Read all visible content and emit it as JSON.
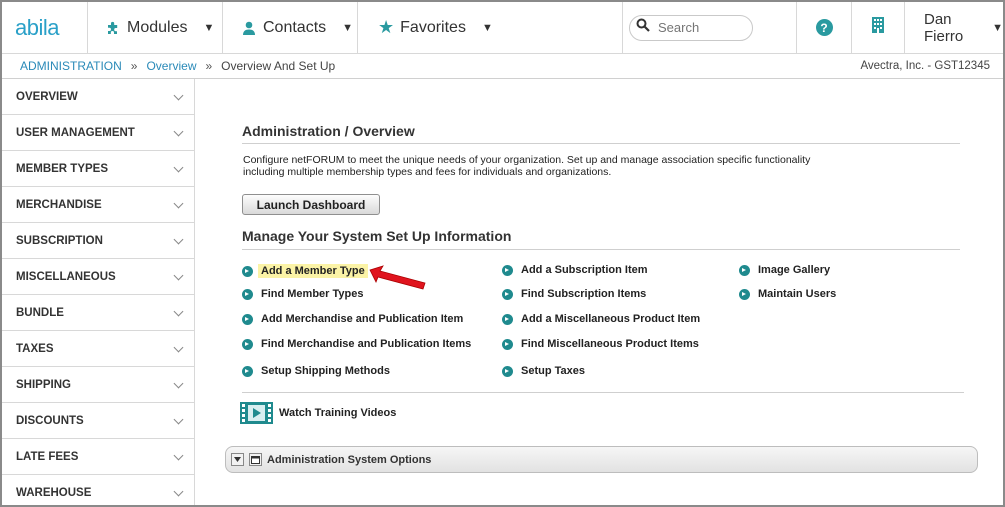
{
  "brand": {
    "logo_text": "abila",
    "accent": "#2aa0c8",
    "icon_color": "#2a9aa0"
  },
  "topnav": {
    "modules": {
      "label": "Modules",
      "icon": "puzzle-icon"
    },
    "contacts": {
      "label": "Contacts",
      "icon": "person-icon"
    },
    "favorites": {
      "label": "Favorites",
      "icon": "star-icon"
    },
    "search": {
      "placeholder": "Search"
    },
    "help_glyph": "?",
    "user": {
      "name": "Dan Fierro"
    }
  },
  "breadcrumb": {
    "items": [
      "ADMINISTRATION",
      "Overview"
    ],
    "separator": "»",
    "current": "Overview And Set Up",
    "org": "Avectra, Inc. - GST12345"
  },
  "sidebar": {
    "items": [
      {
        "label": "OVERVIEW"
      },
      {
        "label": "USER MANAGEMENT"
      },
      {
        "label": "MEMBER TYPES"
      },
      {
        "label": "MERCHANDISE"
      },
      {
        "label": "SUBSCRIPTION"
      },
      {
        "label": "MISCELLANEOUS"
      },
      {
        "label": "BUNDLE"
      },
      {
        "label": "TAXES"
      },
      {
        "label": "SHIPPING"
      },
      {
        "label": "DISCOUNTS"
      },
      {
        "label": "LATE FEES"
      },
      {
        "label": "WAREHOUSE"
      }
    ]
  },
  "main": {
    "heading": "Administration / Overview",
    "description_line1": "Configure netFORUM to meet the unique needs of your organization. Set up and manage association specific functionality",
    "description_line2": "including multiple membership types and fees for individuals and organizations.",
    "launch_button": "Launch Dashboard",
    "setup_heading": "Manage Your System Set Up Information",
    "links": {
      "add_member_type": "Add a Member Type",
      "find_member_types": "Find Member Types",
      "add_merch": "Add Merchandise and Publication Item",
      "find_merch": "Find Merchandise and Publication Items",
      "shipping": "Setup Shipping Methods",
      "add_sub": "Add a Subscription Item",
      "find_sub": "Find Subscription Items",
      "add_misc": "Add a Miscellaneous Product Item",
      "find_misc": "Find Miscellaneous Product Items",
      "taxes": "Setup Taxes",
      "gallery": "Image Gallery",
      "users": "Maintain Users"
    },
    "video_link": "Watch Training Videos",
    "system_options": "Administration System Options",
    "highlight_color": "#fbf3a6",
    "arrow_color": "#e0141e"
  }
}
